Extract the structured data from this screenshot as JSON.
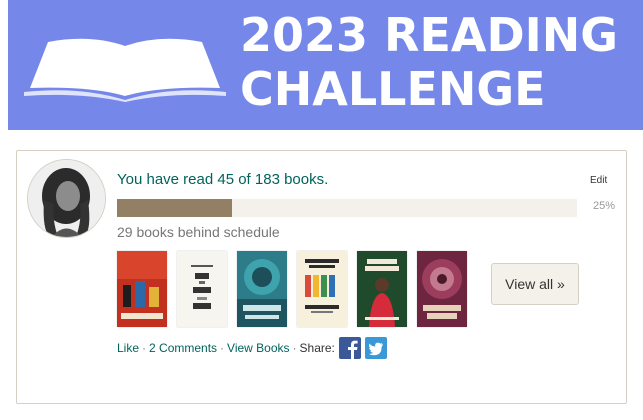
{
  "banner": {
    "title_line1": "2023 READING",
    "title_line2": "CHALLENGE",
    "book_icon": "open-book-icon",
    "background_color": "#7587e8"
  },
  "challenge": {
    "status_text": "You have read 45 of 183 books.",
    "books_read": 45,
    "books_goal": 183,
    "edit_label": "Edit",
    "progress_percent_label": "25%",
    "progress_fraction": 0.25,
    "schedule_text": "29 books behind schedule"
  },
  "covers": [
    {
      "title": "Behold the Dreamers",
      "author": "IMBOLO MBUE",
      "color": "#c2301f"
    },
    {
      "title": "THIS IS HOW YOU HEAL",
      "author": "",
      "color": "#f4f1ea"
    },
    {
      "title": "THE STONE SKY",
      "author": "N.K. JEMISIN",
      "color": "#2c7d89"
    },
    {
      "title": "surrounded by idiots",
      "author": "thomas erikson",
      "color": "#f7f0dc"
    },
    {
      "title": "WOMAN EVOLVE",
      "author": "",
      "color": "#1f4a2c"
    },
    {
      "title": "THE OBELISK GATE",
      "author": "",
      "color": "#8a2f4a"
    }
  ],
  "view_all_label": "View all »",
  "actions": {
    "like": "Like",
    "comments": "2 Comments",
    "view_books": "View Books",
    "share_label": "Share:",
    "facebook_icon": "facebook-icon",
    "twitter_icon": "twitter-icon",
    "facebook_color": "#3b5998",
    "twitter_color": "#3b98d6"
  }
}
